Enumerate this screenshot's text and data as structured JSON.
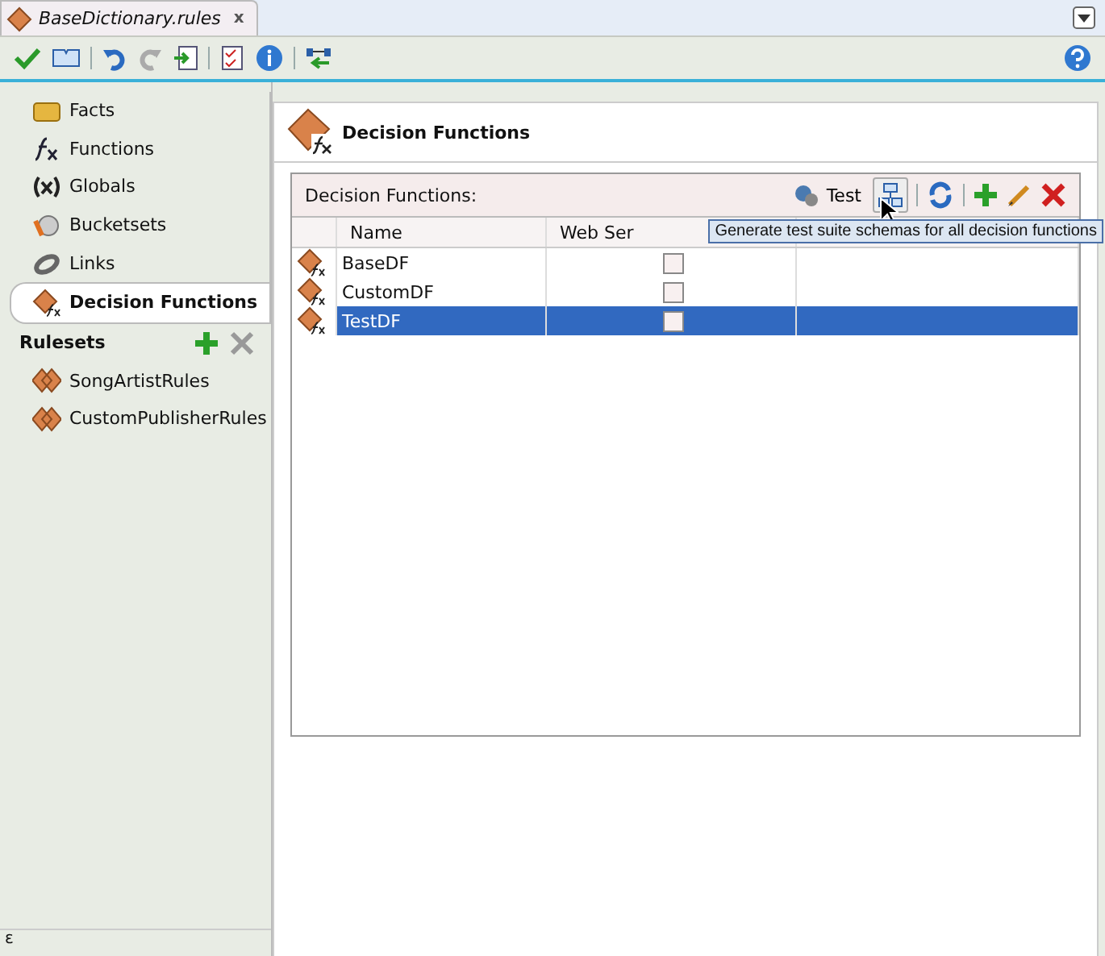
{
  "tab": {
    "title": "BaseDictionary.rules",
    "close": "x"
  },
  "nav": [
    {
      "label": "Facts",
      "kind": "facts",
      "selected": false
    },
    {
      "label": "Functions",
      "kind": "functions",
      "selected": false
    },
    {
      "label": "Globals",
      "kind": "globals",
      "selected": false
    },
    {
      "label": "Bucketsets",
      "kind": "bucketsets",
      "selected": false
    },
    {
      "label": "Links",
      "kind": "links",
      "selected": false
    },
    {
      "label": "Decision Functions",
      "kind": "decision",
      "selected": true
    }
  ],
  "rulesets": {
    "title": "Rulesets",
    "items": [
      {
        "label": "SongArtistRules"
      },
      {
        "label": "CustomPublisherRules"
      }
    ]
  },
  "main": {
    "title": "Decision Functions",
    "panel_title": "Decision Functions:",
    "test_label": "Test",
    "tooltip": "Generate test suite schemas for all decision functions",
    "columns": [
      "Name",
      "Web Ser"
    ],
    "rows": [
      {
        "name": "BaseDF",
        "checked": false,
        "selected": false
      },
      {
        "name": "CustomDF",
        "checked": false,
        "selected": false
      },
      {
        "name": "TestDF",
        "checked": false,
        "selected": true
      }
    ]
  },
  "status": {
    "glyph": "ε"
  }
}
